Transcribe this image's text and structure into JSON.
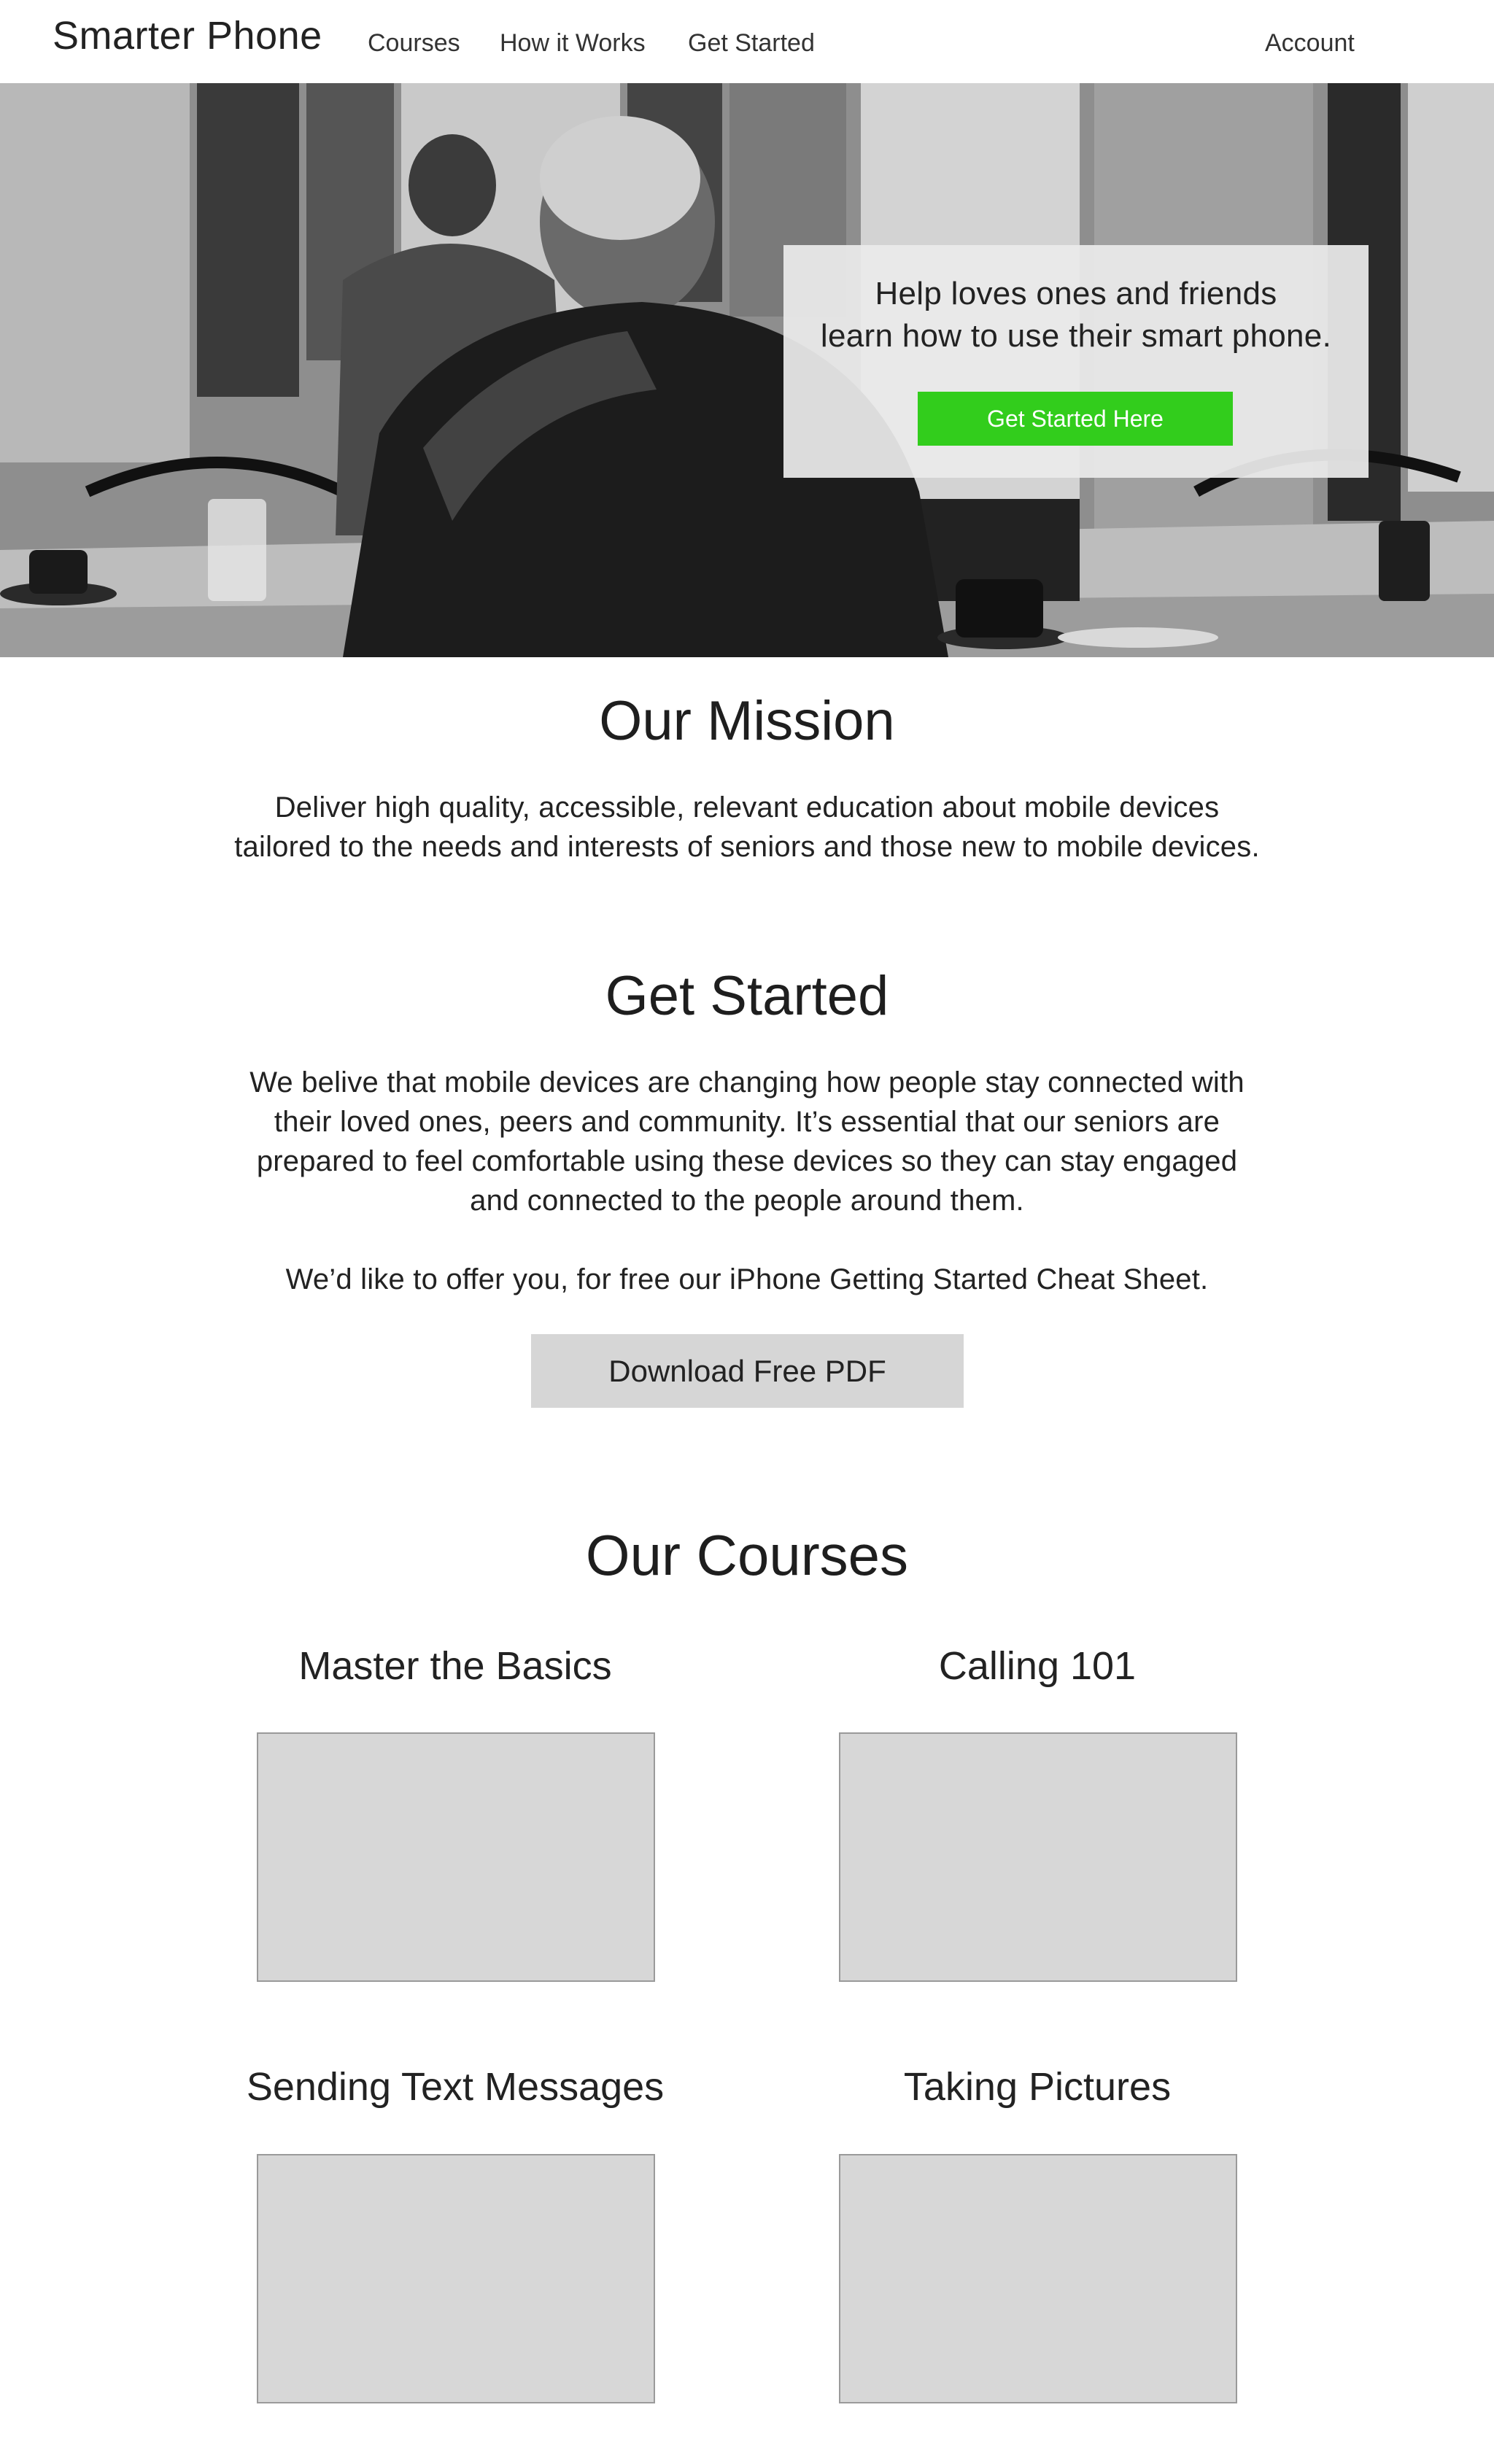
{
  "nav": {
    "brand": "Smarter Phone",
    "links": [
      "Courses",
      "How it Works",
      "Get Started"
    ],
    "account": "Account"
  },
  "hero": {
    "line1": "Help loves ones and friends",
    "line2": "learn how to use their smart phone.",
    "button": "Get Started Here",
    "button_color": "#32cd1c"
  },
  "mission": {
    "title": "Our Mission",
    "lines": [
      "Deliver high quality, accessible, relevant education about mobile devices",
      "tailored to the needs and interests of seniors and those new to mobile devices."
    ]
  },
  "get_started": {
    "title": "Get Started",
    "lines": [
      "We belive that mobile devices are changing how people stay connected with",
      "their loved ones, peers and community. It’s essential that our seniors are",
      "prepared to feel comfortable using these devices so they can stay engaged",
      "and connected to the people around them."
    ],
    "offer": "We’d like to offer you, for free our iPhone Getting Started Cheat Sheet.",
    "button": "Download Free PDF"
  },
  "courses": {
    "title": "Our Courses",
    "items": [
      {
        "title": "Master the Basics"
      },
      {
        "title": "Calling 101"
      },
      {
        "title": "Sending Text Messages"
      },
      {
        "title": "Taking Pictures"
      }
    ]
  }
}
